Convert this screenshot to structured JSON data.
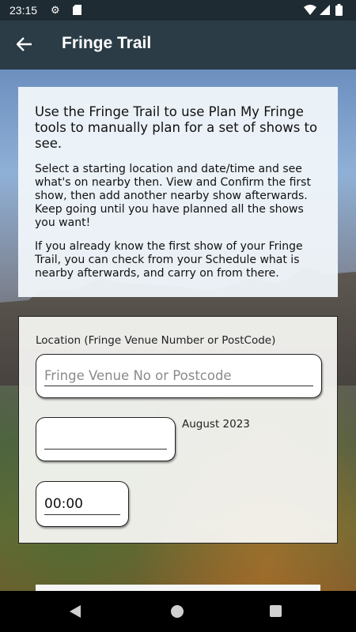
{
  "status_bar": {
    "time": "23:15",
    "icons": [
      "settings-icon",
      "sd-card-icon",
      "wifi-icon",
      "signal-icon",
      "battery-icon"
    ]
  },
  "app_bar": {
    "title": "Fringe Trail",
    "back_icon": "arrow-back-icon"
  },
  "info": {
    "heading": "Use the Fringe Trail to use Plan My Fringe tools to manually plan for a set of shows to see.",
    "paragraph1": "Select a starting location and date/time and see what's on nearby then. View and Confirm the first show, then add another nearby show afterwards. Keep going until you have planned all the shows you want!",
    "paragraph2": "If you already know the first show of your Fringe Trail, you can check from your Schedule what is nearby afterwards, and carry on from there."
  },
  "form": {
    "location_label": "Location (Fringe Venue Number or PostCode)",
    "location_placeholder": "Fringe Venue No or Postcode",
    "location_value": "",
    "date_value": "",
    "month_label": "August 2023",
    "time_value": "00:00"
  },
  "colors": {
    "status_bar": "#1e2b33",
    "app_bar": "#2b3c46",
    "card_bg": "#f0f5fa"
  }
}
